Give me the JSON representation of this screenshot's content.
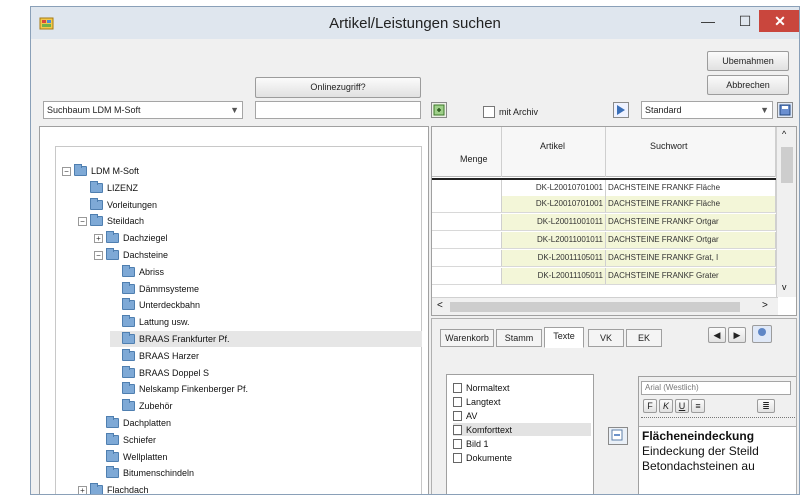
{
  "window": {
    "title": "Artikel/Leistungen suchen",
    "minimize": "—",
    "maximize": "☐",
    "close": "✕"
  },
  "toolbar": {
    "online_button": "Onlinezugriff?",
    "ubernehmen_button": "Ubemahmen",
    "abbrechen_button": "Abbrechen",
    "tree_combo": "Suchbaum LDM M-Soft",
    "archive_label": "mit Archiv",
    "view_combo": "Standard"
  },
  "tree": {
    "items": [
      {
        "label": "LDM M-Soft",
        "level": 0,
        "expander": "−"
      },
      {
        "label": "LIZENZ",
        "level": 1,
        "expander": ""
      },
      {
        "label": "Vorleitungen",
        "level": 1,
        "expander": ""
      },
      {
        "label": "Steildach",
        "level": 1,
        "expander": "−"
      },
      {
        "label": "Dachziegel",
        "level": 2,
        "expander": "+"
      },
      {
        "label": "Dachsteine",
        "level": 2,
        "expander": "−"
      },
      {
        "label": "Abriss",
        "level": 3,
        "expander": ""
      },
      {
        "label": "Dämmsysteme",
        "level": 3,
        "expander": ""
      },
      {
        "label": "Unterdeckbahn",
        "level": 3,
        "expander": ""
      },
      {
        "label": "Lattung usw.",
        "level": 3,
        "expander": ""
      },
      {
        "label": "BRAAS Frankfurter Pf.",
        "level": 3,
        "expander": "",
        "selected": true
      },
      {
        "label": "BRAAS Harzer",
        "level": 3,
        "expander": ""
      },
      {
        "label": "BRAAS Doppel S",
        "level": 3,
        "expander": ""
      },
      {
        "label": "Nelskamp Finkenberger Pf.",
        "level": 3,
        "expander": ""
      },
      {
        "label": "Zubehör",
        "level": 3,
        "expander": ""
      },
      {
        "label": "Dachplatten",
        "level": 2,
        "expander": ""
      },
      {
        "label": "Schiefer",
        "level": 2,
        "expander": ""
      },
      {
        "label": "Wellplatten",
        "level": 2,
        "expander": ""
      },
      {
        "label": "Bitumenschindeln",
        "level": 2,
        "expander": ""
      },
      {
        "label": "Flachdach",
        "level": 1,
        "expander": "+"
      }
    ]
  },
  "grid": {
    "headers": {
      "menge": "Menge",
      "artikel": "Artikel",
      "suchwort": "Suchwort"
    },
    "rows": [
      {
        "artikel": "DK-L20010701001",
        "suchwort": "DACHSTEINE FRANKF Fläche"
      },
      {
        "artikel": "DK-L20010701001",
        "suchwort": "DACHSTEINE FRANKF Fläche"
      },
      {
        "artikel": "DK-L20011001011",
        "suchwort": "DACHSTEINE FRANKF Ortgar"
      },
      {
        "artikel": "DK-L20011001011",
        "suchwort": "DACHSTEINE FRANKF Ortgar"
      },
      {
        "artikel": "DK-L20011105011",
        "suchwort": "DACHSTEINE FRANKF Grat, I"
      },
      {
        "artikel": "DK-L20011105011",
        "suchwort": "DACHSTEINE FRANKF Grater"
      }
    ],
    "scroll_up": "^",
    "scroll_down": "v",
    "scroll_left": "<",
    "scroll_right": ">"
  },
  "detail": {
    "tabs": [
      "Warenkorb",
      "Stamm",
      "Texte",
      "VK",
      "EK"
    ],
    "active_tab": 2,
    "text_types": [
      "Normaltext",
      "Langtext",
      "AV",
      "Komforttext",
      "Bild 1",
      "Dokumente"
    ],
    "selected_text_type": 3,
    "editor": {
      "font": "Arial (Westlich)",
      "line1": "Flächeneindeckung",
      "line2": "Eindeckung der Steild",
      "line3": "Betondachsteinen au"
    }
  }
}
